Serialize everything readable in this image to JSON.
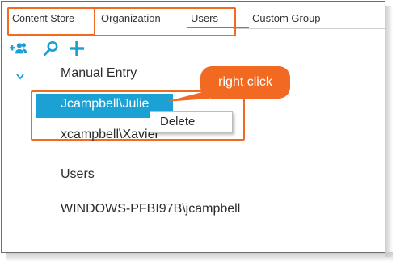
{
  "tabs": {
    "content_store": "Content Store",
    "organization": "Organization",
    "users": "Users",
    "custom_group": "Custom Group"
  },
  "toolbar": {
    "add_users_icon": "add-users-icon",
    "search_icon": "search-icon",
    "add_icon": "plus-icon"
  },
  "tree": {
    "group_label": "Manual Entry",
    "selected_item": "Jcampbell\\Julie",
    "second_item": "xcampbell\\Xavier",
    "users_label": "Users",
    "windows_item": "WINDOWS-PFBI97B\\jcampbell"
  },
  "context_menu": {
    "delete_label": "Delete"
  },
  "callout": {
    "text": "right click"
  },
  "colors": {
    "accent": "#1ba1d4",
    "annotation": "#f26a22"
  }
}
